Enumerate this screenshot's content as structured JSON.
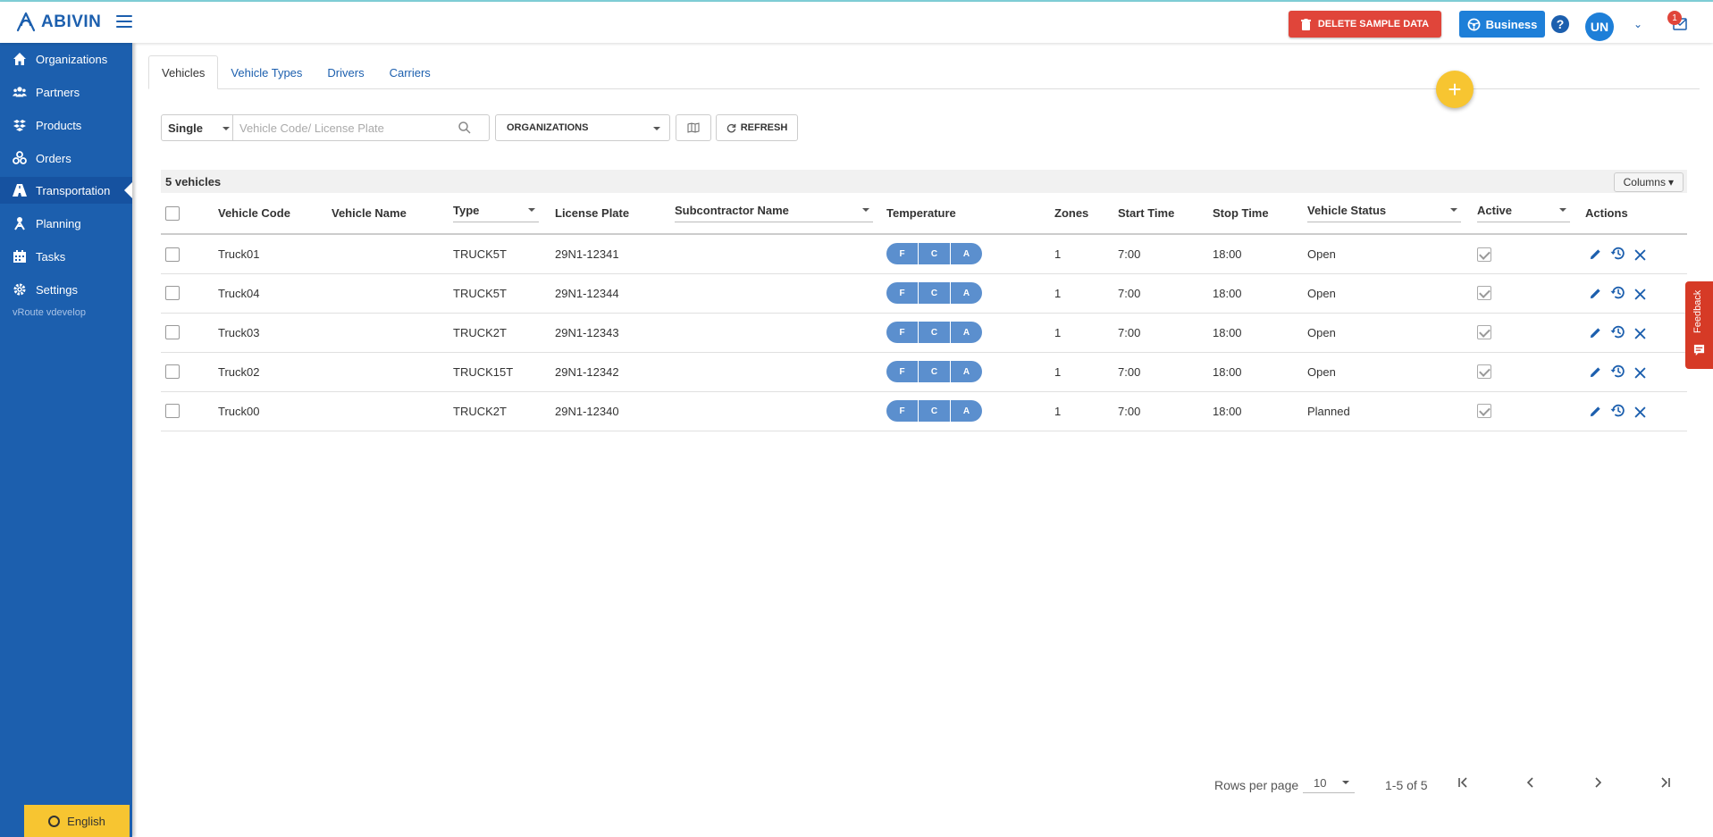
{
  "app": {
    "brand": "ABIVIN",
    "version_text": "vRoute vdevelop"
  },
  "header": {
    "delete_label": "DELETE SAMPLE DATA",
    "business_label": "Business",
    "help_label": "?",
    "avatar_initials": "UN",
    "notification_count": "1"
  },
  "sidebar": {
    "items": [
      {
        "label": "Organizations",
        "icon": "home-icon"
      },
      {
        "label": "Partners",
        "icon": "users-icon"
      },
      {
        "label": "Products",
        "icon": "boxes-icon"
      },
      {
        "label": "Orders",
        "icon": "cubes-icon"
      },
      {
        "label": "Transportation",
        "icon": "road-icon",
        "active": true
      },
      {
        "label": "Planning",
        "icon": "planning-icon"
      },
      {
        "label": "Tasks",
        "icon": "calendar-icon"
      },
      {
        "label": "Settings",
        "icon": "gear-icon"
      }
    ],
    "language_label": "English"
  },
  "tabs": [
    {
      "label": "Vehicles",
      "active": true
    },
    {
      "label": "Vehicle Types"
    },
    {
      "label": "Drivers"
    },
    {
      "label": "Carriers"
    }
  ],
  "filters": {
    "mode_value": "Single",
    "search_placeholder": "Vehicle Code/ License Plate",
    "organizations_label": "ORGANIZATIONS",
    "refresh_label": "REFRESH"
  },
  "table": {
    "count_label": "5 vehicles",
    "columns_button": "Columns",
    "headers": {
      "vehicle_code": "Vehicle Code",
      "vehicle_name": "Vehicle Name",
      "type": "Type",
      "license_plate": "License Plate",
      "subcontractor": "Subcontractor Name",
      "temperature": "Temperature",
      "zones": "Zones",
      "start_time": "Start Time",
      "stop_time": "Stop Time",
      "vehicle_status": "Vehicle Status",
      "active": "Active",
      "actions": "Actions"
    },
    "temperature_labels": [
      "F",
      "C",
      "A"
    ],
    "rows": [
      {
        "code": "Truck01",
        "name": "",
        "type": "TRUCK5T",
        "plate": "29N1-12341",
        "sub": "",
        "zones": "1",
        "start": "7:00",
        "stop": "18:00",
        "status": "Open",
        "active": true
      },
      {
        "code": "Truck04",
        "name": "",
        "type": "TRUCK5T",
        "plate": "29N1-12344",
        "sub": "",
        "zones": "1",
        "start": "7:00",
        "stop": "18:00",
        "status": "Open",
        "active": true
      },
      {
        "code": "Truck03",
        "name": "",
        "type": "TRUCK2T",
        "plate": "29N1-12343",
        "sub": "",
        "zones": "1",
        "start": "7:00",
        "stop": "18:00",
        "status": "Open",
        "active": true
      },
      {
        "code": "Truck02",
        "name": "",
        "type": "TRUCK15T",
        "plate": "29N1-12342",
        "sub": "",
        "zones": "1",
        "start": "7:00",
        "stop": "18:00",
        "status": "Open",
        "active": true
      },
      {
        "code": "Truck00",
        "name": "",
        "type": "TRUCK2T",
        "plate": "29N1-12340",
        "sub": "",
        "zones": "1",
        "start": "7:00",
        "stop": "18:00",
        "status": "Planned",
        "active": true
      }
    ]
  },
  "pagination": {
    "rows_per_page_label": "Rows per page",
    "rows_per_page_value": "10",
    "range_label": "1-5 of 5"
  },
  "feedback_label": "Feedback",
  "colors": {
    "sidebar": "#1c5fae",
    "accent_yellow": "#f7c531",
    "delete_red": "#e0453a",
    "business_blue": "#1e7fd8",
    "temp_pill": "#5b8fce"
  }
}
